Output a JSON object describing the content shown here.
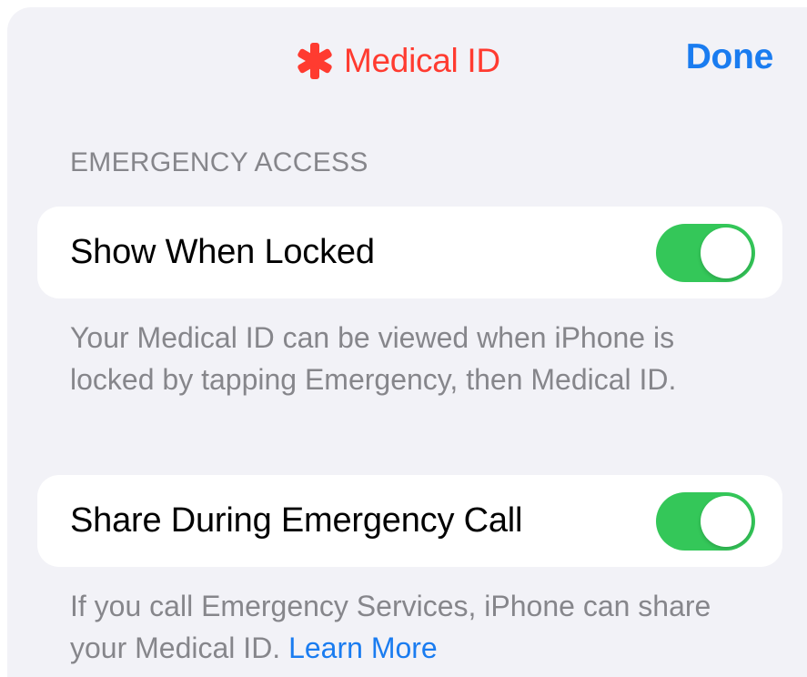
{
  "nav": {
    "title": "Medical ID",
    "title_icon": "asterisk-icon",
    "done_label": "Done"
  },
  "colors": {
    "accent_red": "#ff3b30",
    "link_blue": "#1a7cf0",
    "toggle_on": "#34c759",
    "background": "#f2f2f7",
    "secondary_text": "#86868b"
  },
  "emergency_access": {
    "header": "EMERGENCY ACCESS",
    "show_when_locked": {
      "label": "Show When Locked",
      "enabled": true,
      "footer": "Your Medical ID can be viewed when iPhone is locked by tapping Emergency, then Medical ID."
    },
    "share_during_call": {
      "label": "Share During Emergency Call",
      "enabled": true,
      "footer": "If you call Emergency Services, iPhone can share your Medical ID.",
      "link": "Learn More"
    }
  }
}
